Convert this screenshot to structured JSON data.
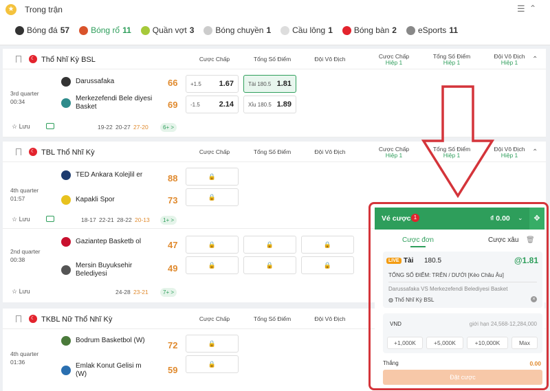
{
  "header": {
    "title": "Trong trận",
    "tabs": [
      {
        "label": "Bóng đá",
        "count": "57",
        "color": "#333333"
      },
      {
        "label": "Bóng rổ",
        "count": "11",
        "color": "#d9532b"
      },
      {
        "label": "Quần vợt",
        "count": "3",
        "color": "#a6c93a"
      },
      {
        "label": "Bóng chuyền",
        "count": "1",
        "color": "#cccccc"
      },
      {
        "label": "Cầu lông",
        "count": "1",
        "color": "#dddddd"
      },
      {
        "label": "Bóng bàn",
        "count": "2",
        "color": "#e3232d"
      },
      {
        "label": "eSports",
        "count": "11",
        "color": "#888888"
      }
    ]
  },
  "columns": {
    "handicap": "Cược Chấp",
    "total": "Tổng Số Điểm",
    "outright": "Đội Vô Địch",
    "half1": "Hiệp 1"
  },
  "leagues": [
    {
      "name": "Thổ Nhĩ Kỳ BSL",
      "matches": [
        {
          "period": "3rd quarter",
          "clock": "00:34",
          "home": "Darussafaka",
          "away": "Merkezefendi Bele diyesi Basket",
          "home_score": "66",
          "away_score": "69",
          "handicap": [
            {
              "line": "+1.5",
              "odds": "1.67"
            },
            {
              "line": "-1.5",
              "odds": "2.14"
            }
          ],
          "total": [
            {
              "line": "Tài 180.5",
              "odds": "1.81"
            },
            {
              "line": "Xỉu 180.5",
              "odds": "1.89"
            }
          ],
          "quarters": [
            "19-22",
            "20-27",
            "27-20"
          ],
          "more": "6+ >",
          "fav": "Lưu"
        }
      ]
    },
    {
      "name": "TBL Thổ Nhĩ Kỳ",
      "matches": [
        {
          "period": "4th quarter",
          "clock": "01:57",
          "home": "TED Ankara Kolejlil er",
          "away": "Kapakli Spor",
          "home_score": "88",
          "away_score": "73",
          "quarters": [
            "18-17",
            "22-21",
            "28-22",
            "20-13"
          ],
          "more": "1+ >",
          "fav": "Lưu"
        },
        {
          "period": "2nd quarter",
          "clock": "00:38",
          "home": "Gaziantep Basketb ol",
          "away": "Mersin Buyuksehir Belediyesi",
          "home_score": "47",
          "away_score": "49",
          "quarters": [
            "24-28",
            "23-21"
          ],
          "more": "7+ >",
          "fav": "Lưu"
        }
      ]
    },
    {
      "name": "TKBL Nữ Thổ Nhĩ Kỳ",
      "matches": [
        {
          "period": "4th quarter",
          "clock": "01:36",
          "home": "Bodrum Basketbol (W)",
          "away": "Emlak Konut Gelisi m (W)",
          "home_score": "72",
          "away_score": "59"
        }
      ]
    }
  ],
  "betslip": {
    "title": "Vé cược",
    "badge": "1",
    "balance": "₫ 0.00",
    "tab_single": "Cược đơn",
    "tab_parlay": "Cược xâu",
    "live": "LIVE",
    "selection": "Tài",
    "line": "180.5",
    "odds": "@1.81",
    "market": "TỔNG SỐ ĐIỂM: TRÊN / DƯỚI   [Kèo Châu Âu]",
    "matchup": "Darussafaka VS Merkezefendi Belediyesi Basket",
    "league": "Thổ Nhĩ Kỳ BSL",
    "currency": "VND",
    "limit": "giới hạn 24,568-12,284,000",
    "quick": [
      "+1,000K",
      "+5,000K",
      "+10,000K",
      "Max"
    ],
    "win_label": "Thắng",
    "win_value": "0.00",
    "place": "Đặt cược"
  }
}
